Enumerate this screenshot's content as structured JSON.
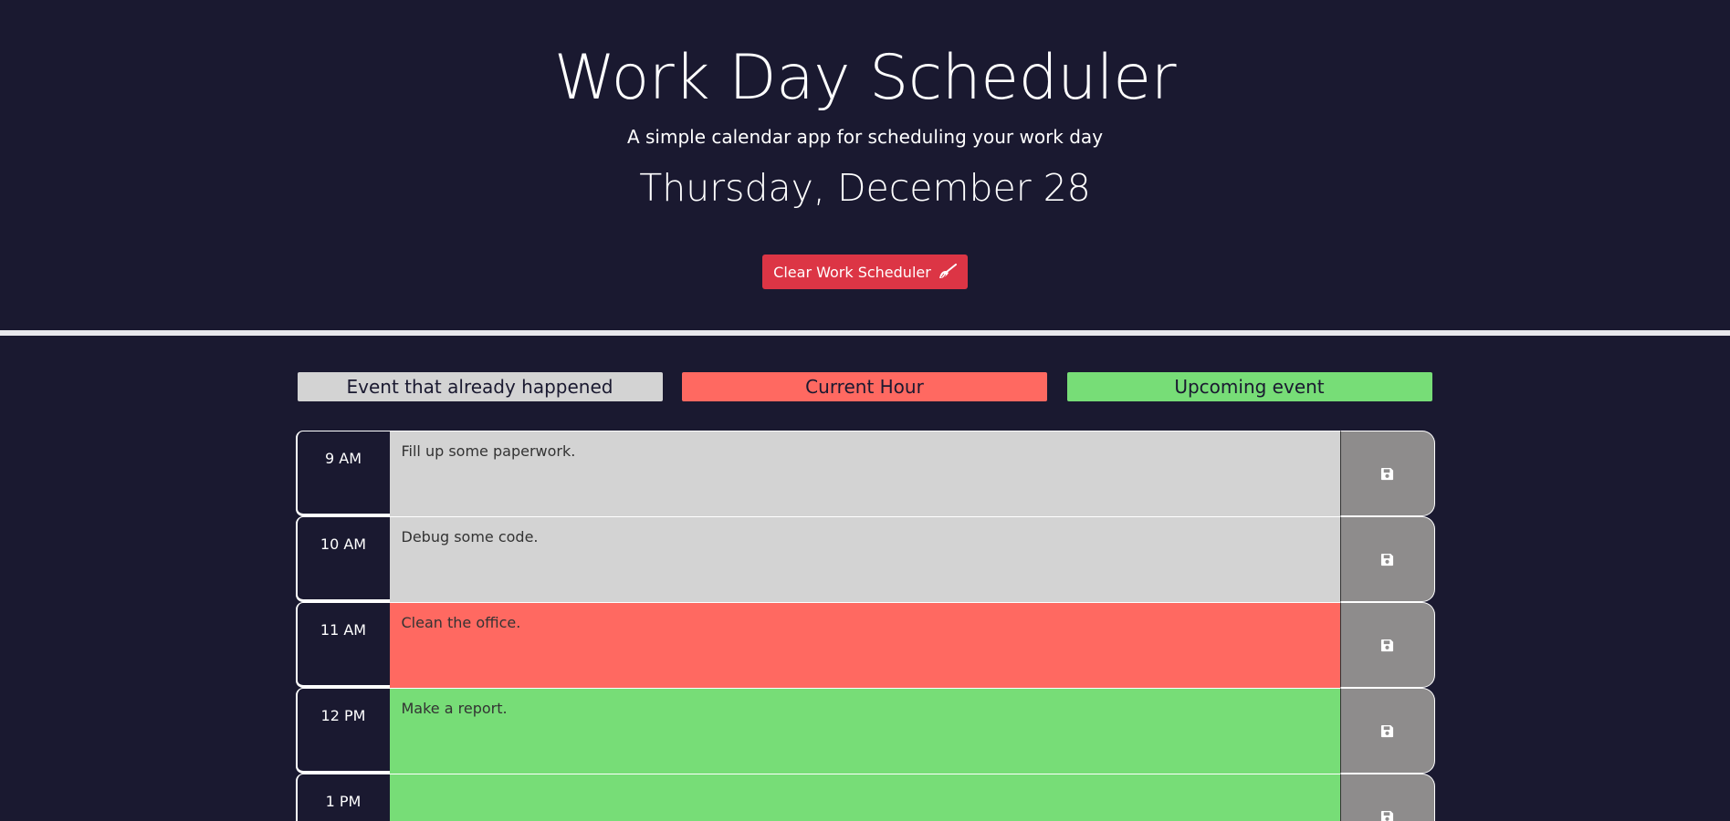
{
  "header": {
    "title": "Work Day Scheduler",
    "subtitle": "A simple calendar app for scheduling your work day",
    "current_date": "Thursday, December 28",
    "clear_button_label": "Clear Work Scheduler",
    "clear_button_icon": "broom-icon"
  },
  "legend": {
    "past": "Event that already happened",
    "present": "Current Hour",
    "future": "Upcoming event"
  },
  "colors": {
    "background": "#1a1930",
    "past": "#d3d3d3",
    "present": "#ff6961",
    "future": "#77dd77",
    "save": "#8e8c8c",
    "clear_button": "#dc3545"
  },
  "rows": [
    {
      "hour": "9 AM",
      "text": "Fill up some paperwork.",
      "status": "past",
      "save_icon": "floppy-disk-icon"
    },
    {
      "hour": "10 AM",
      "text": "Debug some code.",
      "status": "past",
      "save_icon": "floppy-disk-icon"
    },
    {
      "hour": "11 AM",
      "text": "Clean the office.",
      "status": "present",
      "save_icon": "floppy-disk-icon"
    },
    {
      "hour": "12 PM",
      "text": "Make a report.",
      "status": "future",
      "save_icon": "floppy-disk-icon"
    },
    {
      "hour": "1 PM",
      "text": "",
      "status": "future",
      "save_icon": "floppy-disk-icon"
    }
  ]
}
